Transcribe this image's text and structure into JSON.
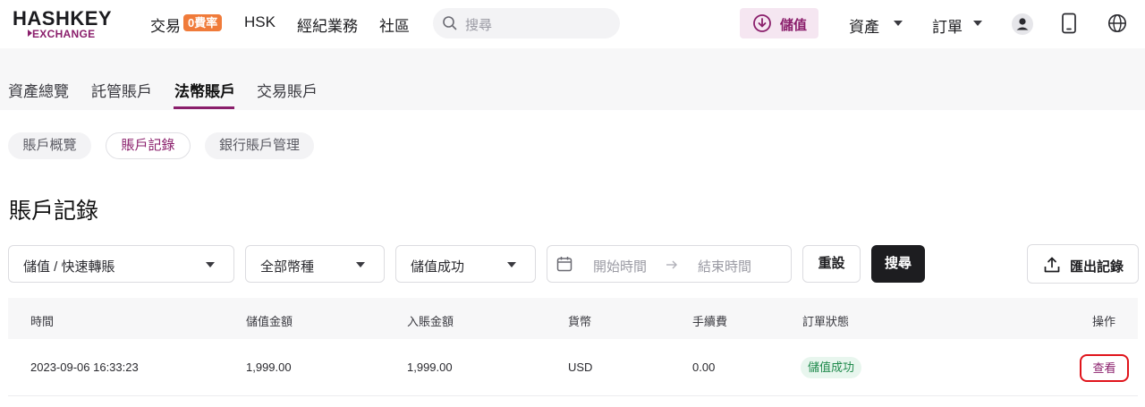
{
  "header": {
    "logo_line1": "HASHKEY",
    "logo_line2": "EXCHANGE",
    "nav": {
      "trade": "交易",
      "trade_badge": "0費率",
      "hsk": "HSK",
      "broker": "經紀業務",
      "community": "社區"
    },
    "search_placeholder": "搜尋",
    "deposit_label": "儲值",
    "assets_label": "資產",
    "orders_label": "訂單",
    "icons": [
      "user-avatar-icon",
      "mobile-icon",
      "globe-icon"
    ]
  },
  "tabs": [
    {
      "label": "資產總覽",
      "active": false
    },
    {
      "label": "託管賬戶",
      "active": false
    },
    {
      "label": "法幣賬戶",
      "active": true
    },
    {
      "label": "交易賬戶",
      "active": false
    }
  ],
  "subtabs": [
    {
      "label": "賬戶概覽",
      "active": false
    },
    {
      "label": "賬戶記錄",
      "active": true
    },
    {
      "label": "銀行賬戶管理",
      "active": false
    }
  ],
  "page_title": "賬戶記錄",
  "filters": {
    "type": "儲值 / 快速轉賬",
    "currency": "全部幣種",
    "status": "儲值成功",
    "start_placeholder": "開始時間",
    "end_placeholder": "結束時間",
    "reset": "重設",
    "search": "搜尋",
    "export": "匯出記錄"
  },
  "table": {
    "headers": [
      "時間",
      "儲值金額",
      "入賬金額",
      "貨幣",
      "手續費",
      "訂單狀態",
      "操作"
    ],
    "rows": [
      {
        "time": "2023-09-06 16:33:23",
        "deposit_amount": "1,999.00",
        "credited_amount": "1,999.00",
        "currency": "USD",
        "fee": "0.00",
        "status": "儲值成功",
        "action": "查看"
      }
    ]
  },
  "colors": {
    "brand": "#8a1e6b",
    "badge_orange": "#f07b3a",
    "status_green": "#1f8a4c",
    "highlight_red": "#e0141b"
  }
}
